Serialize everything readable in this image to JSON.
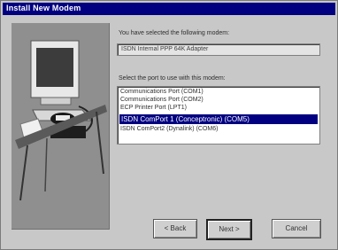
{
  "window": {
    "title": "Install New Modem"
  },
  "main": {
    "selected_label": "You have selected the following modem:",
    "selected_value": "ISDN Internal PPP 64K Adapter",
    "port_label": "Select the port to use with this modem:",
    "ports": [
      {
        "label": "Communications Port (COM1)",
        "selected": false
      },
      {
        "label": "Communications Port (COM2)",
        "selected": false
      },
      {
        "label": "ECP Printer Port (LPT1)",
        "selected": false
      },
      {
        "label": "ISDN ComPort 1 (Conceptronic) (COM5)",
        "selected": true
      },
      {
        "label": "ISDN ComPort2 (Dynalink) (COM6)",
        "selected": false
      }
    ]
  },
  "buttons": {
    "back": "< Back",
    "next": "Next >",
    "cancel": "Cancel"
  },
  "icons": {
    "illustration": "computer-modem-phone-illustration"
  },
  "colors": {
    "titlebar": "#000080",
    "selection": "#000080",
    "face": "#c8c8c8"
  }
}
